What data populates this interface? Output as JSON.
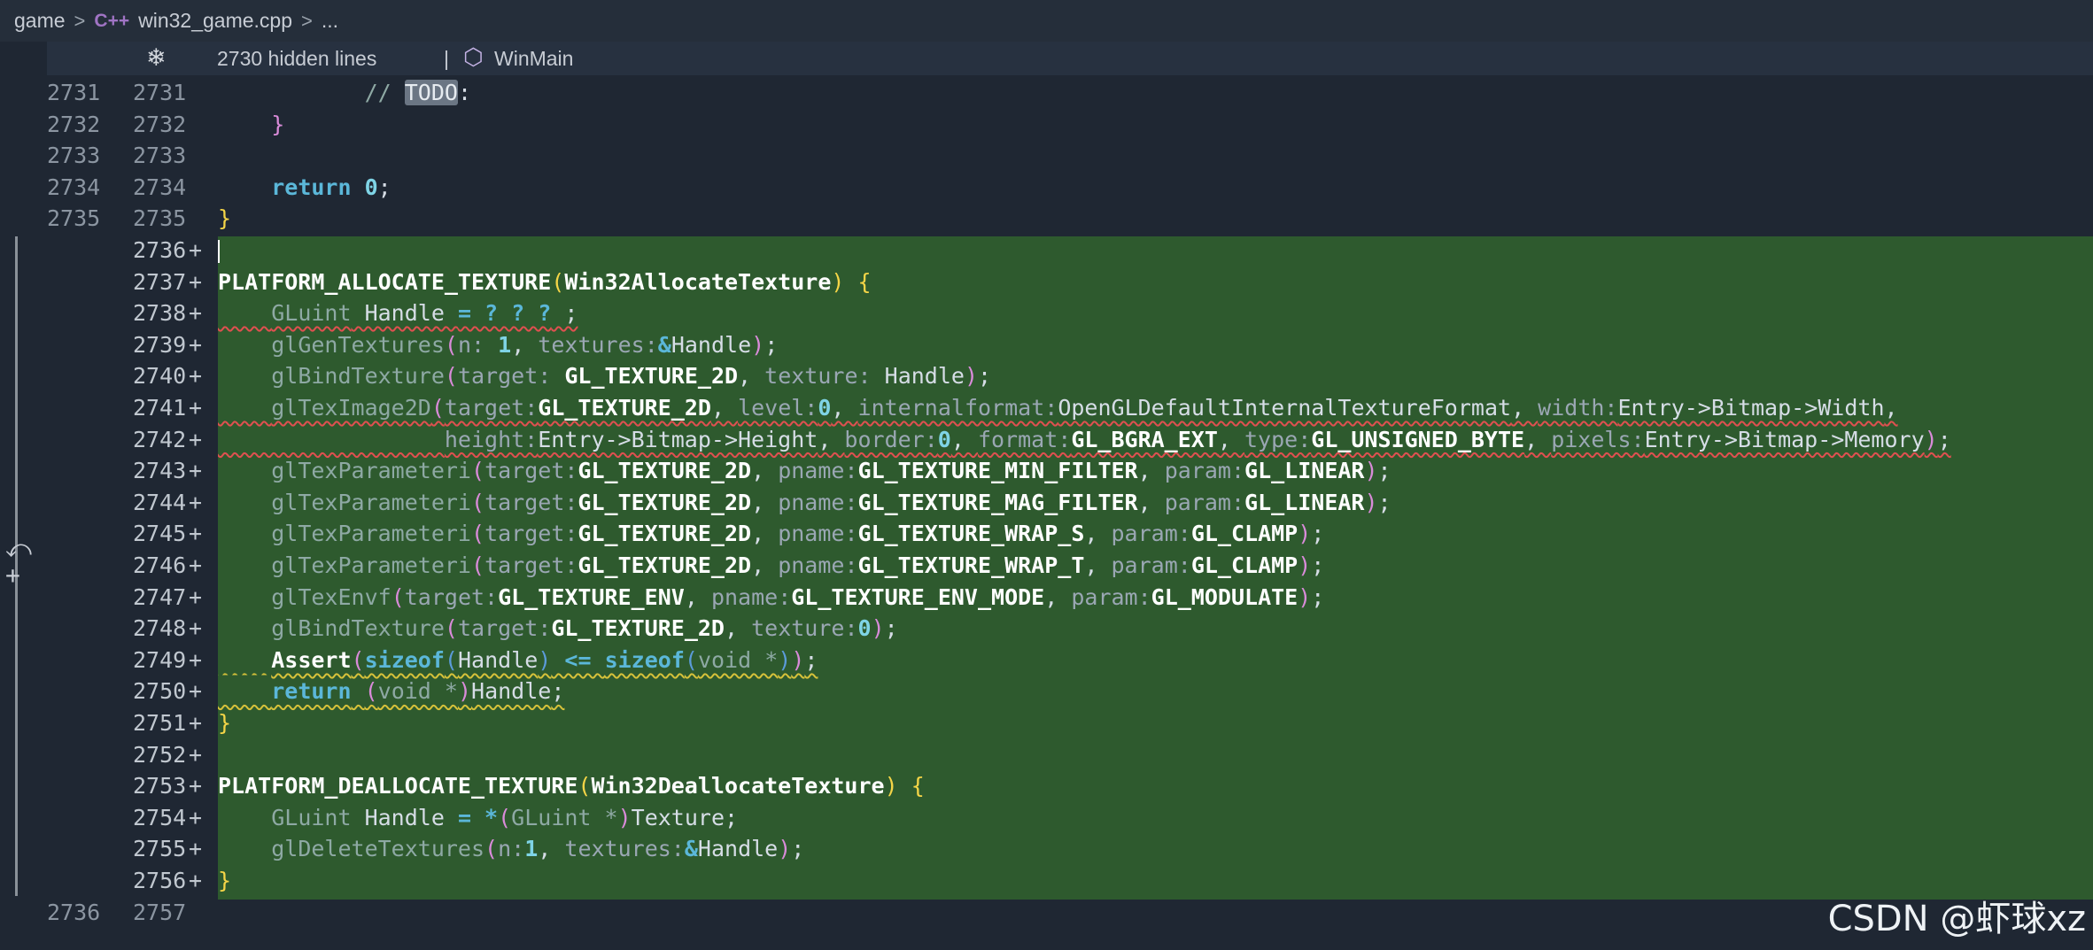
{
  "breadcrumb": {
    "root": "game",
    "sep": ">",
    "file_icon": "cpp-file-icon",
    "file_icon_glyph": "C++",
    "file": "win32_game.cpp",
    "tail": "..."
  },
  "fold_bar": {
    "unfold_icon": "unfold-icon",
    "hidden_lines": "2730 hidden lines",
    "pipe": "|",
    "symbol_icon": "cube-icon",
    "function_name": "WinMain"
  },
  "lines": [
    {
      "old": "2731",
      "new": "2731",
      "plus": ""
    },
    {
      "old": "2732",
      "new": "2732",
      "plus": ""
    },
    {
      "old": "2733",
      "new": "2733",
      "plus": ""
    },
    {
      "old": "2734",
      "new": "2734",
      "plus": ""
    },
    {
      "old": "2735",
      "new": "2735",
      "plus": ""
    },
    {
      "old": "",
      "new": "2736",
      "plus": "+"
    },
    {
      "old": "",
      "new": "2737",
      "plus": "+"
    },
    {
      "old": "",
      "new": "2738",
      "plus": "+"
    },
    {
      "old": "",
      "new": "2739",
      "plus": "+"
    },
    {
      "old": "",
      "new": "2740",
      "plus": "+"
    },
    {
      "old": "",
      "new": "2741",
      "plus": "+"
    },
    {
      "old": "",
      "new": "2742",
      "plus": "+"
    },
    {
      "old": "",
      "new": "2743",
      "plus": "+"
    },
    {
      "old": "",
      "new": "2744",
      "plus": "+"
    },
    {
      "old": "",
      "new": "2745",
      "plus": "+"
    },
    {
      "old": "",
      "new": "2746",
      "plus": "+"
    },
    {
      "old": "",
      "new": "2747",
      "plus": "+"
    },
    {
      "old": "",
      "new": "2748",
      "plus": "+"
    },
    {
      "old": "",
      "new": "2749",
      "plus": "+"
    },
    {
      "old": "",
      "new": "2750",
      "plus": "+"
    },
    {
      "old": "",
      "new": "2751",
      "plus": "+"
    },
    {
      "old": "",
      "new": "2752",
      "plus": "+"
    },
    {
      "old": "",
      "new": "2753",
      "plus": "+"
    },
    {
      "old": "",
      "new": "2754",
      "plus": "+"
    },
    {
      "old": "",
      "new": "2755",
      "plus": "+"
    },
    {
      "old": "",
      "new": "2756",
      "plus": "+"
    },
    {
      "old": "2736",
      "new": "2757",
      "plus": ""
    }
  ],
  "code": {
    "l2731": {
      "comment": "// ",
      "todo": "TODO",
      "colon": ":"
    },
    "l2732": {
      "brace": "}"
    },
    "l2734": {
      "kw": "return",
      "sp": " ",
      "num": "0",
      "semi": ";"
    },
    "l2735": {
      "brace": "}"
    },
    "l2737": {
      "macro": "PLATFORM_ALLOCATE_TEXTURE",
      "open": "(",
      "name": "Win32AllocateTexture",
      "close": ")",
      "sp": " ",
      "brace": "{"
    },
    "l2738": {
      "type": "GLuint",
      "var": " Handle ",
      "eq": "= ? ? ?",
      "end": " ;"
    },
    "l2739": {
      "fn": "glGenTextures",
      "open": "(",
      "h1": "n:",
      "sp1": " ",
      "v1": "1",
      "c1": ", ",
      "h2": "textures:",
      "amp": "&",
      "v2": "Handle",
      "close": ")",
      "semi": ";"
    },
    "l2740": {
      "fn": "glBindTexture",
      "open": "(",
      "h1": "target:",
      "sp": " ",
      "v1": "GL_TEXTURE_2D",
      "c1": ", ",
      "h2": "texture:",
      "v2": "Handle",
      "close": ")",
      "semi": ";"
    },
    "l2741": {
      "fn": "glTexImage2D",
      "open": "(",
      "h1": "target:",
      "v1": "GL_TEXTURE_2D",
      "c": ", ",
      "h2": "level:",
      "v2": "0",
      "h3": "internalformat:",
      "v3": "OpenGLDefaultInternalTextureFormat",
      "h4": "width:",
      "v4": "Entry->Bitmap->Width",
      "tail": ","
    },
    "l2742": {
      "h1": "height:",
      "v1": "Entry->Bitmap->Height",
      "c": ", ",
      "h2": "border:",
      "v2": "0",
      "h3": "format:",
      "v3": "GL_BGRA_EXT",
      "h4": "type:",
      "v4": "GL_UNSIGNED_BYTE",
      "h5": "pixels:",
      "v5": "Entry->Bitmap->Memory",
      "close": ")",
      "semi": ";"
    },
    "l2743": {
      "fn": "glTexParameteri",
      "open": "(",
      "h1": "target:",
      "v1": "GL_TEXTURE_2D",
      "c": ", ",
      "h2": "pname:",
      "v2": "GL_TEXTURE_MIN_FILTER",
      "h3": "param:",
      "v3": "GL_LINEAR",
      "close": ")",
      "semi": ";"
    },
    "l2744": {
      "fn": "glTexParameteri",
      "open": "(",
      "h1": "target:",
      "v1": "GL_TEXTURE_2D",
      "c": ", ",
      "h2": "pname:",
      "v2": "GL_TEXTURE_MAG_FILTER",
      "h3": "param:",
      "v3": "GL_LINEAR",
      "close": ")",
      "semi": ";"
    },
    "l2745": {
      "fn": "glTexParameteri",
      "open": "(",
      "h1": "target:",
      "v1": "GL_TEXTURE_2D",
      "c": ", ",
      "h2": "pname:",
      "v2": "GL_TEXTURE_WRAP_S",
      "h3": "param:",
      "v3": "GL_CLAMP",
      "close": ")",
      "semi": ";"
    },
    "l2746": {
      "fn": "glTexParameteri",
      "open": "(",
      "h1": "target:",
      "v1": "GL_TEXTURE_2D",
      "c": ", ",
      "h2": "pname:",
      "v2": "GL_TEXTURE_WRAP_T",
      "h3": "param:",
      "v3": "GL_CLAMP",
      "close": ")",
      "semi": ";"
    },
    "l2747": {
      "fn": "glTexEnvf",
      "open": "(",
      "h1": "target:",
      "v1": "GL_TEXTURE_ENV",
      "c": ", ",
      "h2": "pname:",
      "v2": "GL_TEXTURE_ENV_MODE",
      "h3": "param:",
      "v3": "GL_MODULATE",
      "close": ")",
      "semi": ";"
    },
    "l2748": {
      "fn": "glBindTexture",
      "open": "(",
      "h1": "target:",
      "v1": "GL_TEXTURE_2D",
      "c": ", ",
      "h2": "texture:",
      "v2": "0",
      "close": ")",
      "semi": ";"
    },
    "l2749": {
      "fn": "Assert",
      "open": "(",
      "k1": "sizeof",
      "o2": "(",
      "v1": "Handle",
      "c2": ")",
      "op": " <= ",
      "k2": "sizeof",
      "o3": "(",
      "v2": "void *",
      "c3": ")",
      "close": ")",
      "semi": ";"
    },
    "l2750": {
      "kw": "return",
      "sp": " ",
      "open": "(",
      "type": "void *",
      "close": ")",
      "var": "Handle",
      "semi": ";"
    },
    "l2751": {
      "brace": "}"
    },
    "l2753": {
      "macro": "PLATFORM_DEALLOCATE_TEXTURE",
      "open": "(",
      "name": "Win32DeallocateTexture",
      "close": ")",
      "sp": " ",
      "brace": "{"
    },
    "l2754": {
      "type": "GLuint",
      "var": " Handle ",
      "eq": "= *",
      "open": "(",
      "type2": "GLuint *",
      "close": ")",
      "val": "Texture",
      "semi": ";"
    },
    "l2755": {
      "fn": "glDeleteTextures",
      "open": "(",
      "h1": "n:",
      "v1": "1",
      "c": ", ",
      "h2": "textures:",
      "amp": "&",
      "v2": "Handle",
      "close": ")",
      "semi": ";"
    },
    "l2756": {
      "brace": "}"
    }
  },
  "watermark": "CSDN @虾球xz",
  "colors": {
    "added_bg": "#2e5a2e",
    "editor_bg": "#1f2733",
    "keyword": "#5bb7d9",
    "brace": "#f5d547"
  }
}
